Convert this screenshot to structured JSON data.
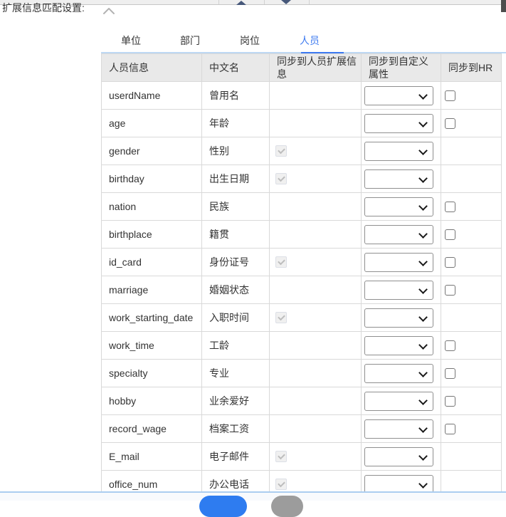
{
  "header": {
    "section_label": "扩展信息匹配设置:",
    "collapse_icon": "chevron-up",
    "toolbar_icons": [
      "triangle-up",
      "triangle-down"
    ]
  },
  "tabs": {
    "items": [
      {
        "label": "单位",
        "active": false
      },
      {
        "label": "部门",
        "active": false
      },
      {
        "label": "岗位",
        "active": false
      },
      {
        "label": "人员",
        "active": true
      }
    ]
  },
  "table": {
    "columns": [
      "人员信息",
      "中文名",
      "同步到人员扩展信息",
      "同步到自定义属性",
      "同步到HR"
    ],
    "rows": [
      {
        "field": "userdName",
        "chinese_name": "曾用名",
        "ext_sync_checkbox": "none",
        "custom_attr_select_value": "",
        "hr_checkbox": "unchecked"
      },
      {
        "field": "age",
        "chinese_name": "年龄",
        "ext_sync_checkbox": "none",
        "custom_attr_select_value": "",
        "hr_checkbox": "unchecked"
      },
      {
        "field": "gender",
        "chinese_name": "性别",
        "ext_sync_checkbox": "checked_disabled",
        "custom_attr_select_value": "",
        "hr_checkbox": "none"
      },
      {
        "field": "birthday",
        "chinese_name": "出生日期",
        "ext_sync_checkbox": "checked_disabled",
        "custom_attr_select_value": "",
        "hr_checkbox": "none"
      },
      {
        "field": "nation",
        "chinese_name": "民族",
        "ext_sync_checkbox": "none",
        "custom_attr_select_value": "",
        "hr_checkbox": "unchecked"
      },
      {
        "field": "birthplace",
        "chinese_name": "籍贯",
        "ext_sync_checkbox": "none",
        "custom_attr_select_value": "",
        "hr_checkbox": "unchecked"
      },
      {
        "field": "id_card",
        "chinese_name": "身份证号",
        "ext_sync_checkbox": "checked_disabled",
        "custom_attr_select_value": "",
        "hr_checkbox": "unchecked"
      },
      {
        "field": "marriage",
        "chinese_name": "婚姻状态",
        "ext_sync_checkbox": "none",
        "custom_attr_select_value": "",
        "hr_checkbox": "unchecked"
      },
      {
        "field": "work_starting_date",
        "chinese_name": "入职时间",
        "ext_sync_checkbox": "checked_disabled",
        "custom_attr_select_value": "",
        "hr_checkbox": "none"
      },
      {
        "field": "work_time",
        "chinese_name": "工龄",
        "ext_sync_checkbox": "none",
        "custom_attr_select_value": "",
        "hr_checkbox": "unchecked"
      },
      {
        "field": "specialty",
        "chinese_name": "专业",
        "ext_sync_checkbox": "none",
        "custom_attr_select_value": "",
        "hr_checkbox": "unchecked"
      },
      {
        "field": "hobby",
        "chinese_name": "业余爱好",
        "ext_sync_checkbox": "none",
        "custom_attr_select_value": "",
        "hr_checkbox": "unchecked"
      },
      {
        "field": "record_wage",
        "chinese_name": "档案工资",
        "ext_sync_checkbox": "none",
        "custom_attr_select_value": "",
        "hr_checkbox": "unchecked"
      },
      {
        "field": "E_mail",
        "chinese_name": "电子邮件",
        "ext_sync_checkbox": "checked_disabled",
        "custom_attr_select_value": "",
        "hr_checkbox": "none"
      },
      {
        "field": "office_num",
        "chinese_name": "办公电话",
        "ext_sync_checkbox": "checked_disabled",
        "custom_attr_select_value": "",
        "hr_checkbox": "none"
      }
    ]
  },
  "footer": {
    "confirm_button_label": "",
    "cancel_button_label": ""
  },
  "colors": {
    "accent_blue": "#3d7af0",
    "button_blue": "#2e7cf0",
    "button_gray": "#9c9c9c",
    "header_bg": "#e9e9e9",
    "cell_border": "#d9d9d9",
    "tab_divider_blue": "#bdd8f3",
    "bottom_divider_blue": "#abcdf0",
    "toolbar_bg": "#efefef"
  }
}
